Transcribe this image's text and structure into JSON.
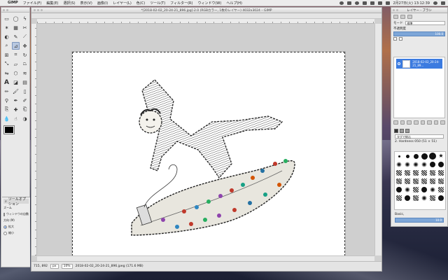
{
  "menubar": {
    "app": "GIMP",
    "items": [
      "ファイル(F)",
      "編集(E)",
      "選択(S)",
      "表示(V)",
      "画像(I)",
      "レイヤー(L)",
      "色(C)",
      "ツール(T)",
      "フィルター(R)",
      "ウィンドウ(W)",
      "ヘルプ(H)"
    ],
    "clock": "2月27日(火) 13:12:39"
  },
  "image_window": {
    "title": "*[2018-02-02_20-24-21_896.jpg]-2.0 (RGBカラー, 1枚のレイヤー) 4032x3024 – GIMP",
    "status": {
      "coords": "715, 892",
      "unit": "px",
      "zoom": "10%",
      "file": "2018-02-02_20-24-21_896.jpeg (171.6 MB)"
    }
  },
  "toolbox": {
    "options_tab": "ツールオプション",
    "options_title": "ズーム",
    "resize_window": "ウィンドウの自動",
    "direction_label": "方向 (M)",
    "zoom_in": "拡大",
    "zoom_out": "縮小"
  },
  "layers_dock": {
    "title": "レイヤー - ブラシ",
    "mode_label": "モード",
    "mode_value": "標準",
    "opacity_label": "不透明度",
    "opacity_value": "100.0",
    "layer_name": "2018-02-02_20-24-21_89..."
  },
  "brushes": {
    "filter_label": "タグで絞込",
    "brush_name": "2. Hardness 050 (51 × 51)",
    "preset_label": "Basic,",
    "spacing_value": "10.0"
  }
}
